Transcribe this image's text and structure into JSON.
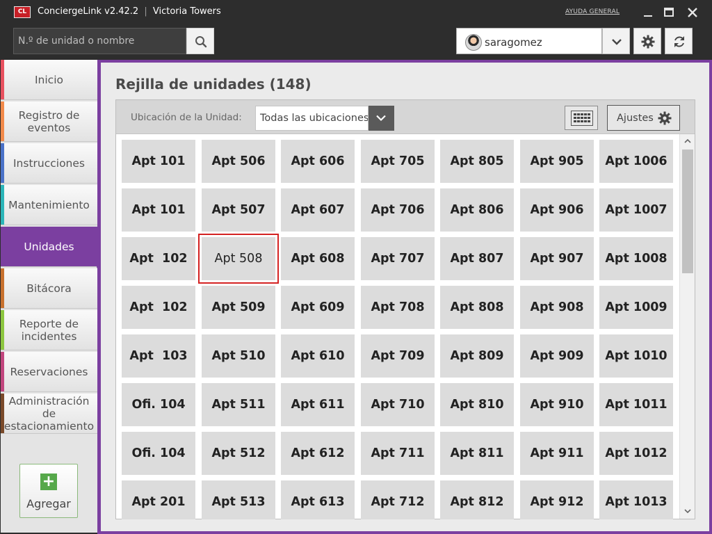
{
  "app": {
    "logo_text": "CL",
    "name": "ConciergeLink v2.42.2",
    "separator": "|",
    "building": "Victoria Towers",
    "help_label": "AYUDA GENERAL"
  },
  "search": {
    "placeholder": "N.º de unidad o nombre"
  },
  "user": {
    "name": "saragomez"
  },
  "sidebar": {
    "items": [
      {
        "label": "Inicio",
        "color": "#e8515f"
      },
      {
        "label": "Registro de eventos",
        "color": "#f28a4a"
      },
      {
        "label": "Instrucciones",
        "color": "#4a72c8"
      },
      {
        "label": "Mantenimiento",
        "color": "#2bb5b8"
      },
      {
        "label": "Unidades",
        "color": "#7b3fa0"
      },
      {
        "label": "Bitácora",
        "color": "#c8712e"
      },
      {
        "label": "Reporte de incidentes",
        "color": "#8cc63f"
      },
      {
        "label": "Reservaciones",
        "color": "#c2467e"
      },
      {
        "label": "Administración de estacionamiento",
        "color": "#7a4a2a"
      }
    ],
    "active": "Unidades",
    "add_label": "Agregar",
    "add_symbol": "+"
  },
  "main": {
    "title": "Rejilla de unidades (148)",
    "filter_label": "Ubicación de la Unidad:",
    "location_value": "Todas las ubicaciones",
    "settings_label": "Ajustes",
    "selected_unit": "Apt 508",
    "accent_color": "#7b3fa0",
    "selection_color": "#d42222"
  },
  "units": [
    [
      "Apt 101",
      "Apt 506",
      "Apt 606",
      "Apt 705",
      "Apt 805",
      "Apt 905",
      "Apt 1006"
    ],
    [
      "Apt 101",
      "Apt 507",
      "Apt 607",
      "Apt 706",
      "Apt 806",
      "Apt 906",
      "Apt 1007"
    ],
    [
      "Apt  102",
      "Apt 508",
      "Apt 608",
      "Apt 707",
      "Apt 807",
      "Apt 907",
      "Apt 1008"
    ],
    [
      "Apt  102",
      "Apt 509",
      "Apt 609",
      "Apt 708",
      "Apt 808",
      "Apt 908",
      "Apt 1009"
    ],
    [
      "Apt  103",
      "Apt 510",
      "Apt 610",
      "Apt 709",
      "Apt 809",
      "Apt 909",
      "Apt 1010"
    ],
    [
      "Ofi. 104",
      "Apt 511",
      "Apt 611",
      "Apt 710",
      "Apt 810",
      "Apt 910",
      "Apt 1011"
    ],
    [
      "Ofi. 104",
      "Apt 512",
      "Apt 612",
      "Apt 711",
      "Apt 811",
      "Apt 911",
      "Apt 1012"
    ],
    [
      "Apt 201",
      "Apt 513",
      "Apt 613",
      "Apt 712",
      "Apt 812",
      "Apt 912",
      "Apt 1013"
    ]
  ]
}
